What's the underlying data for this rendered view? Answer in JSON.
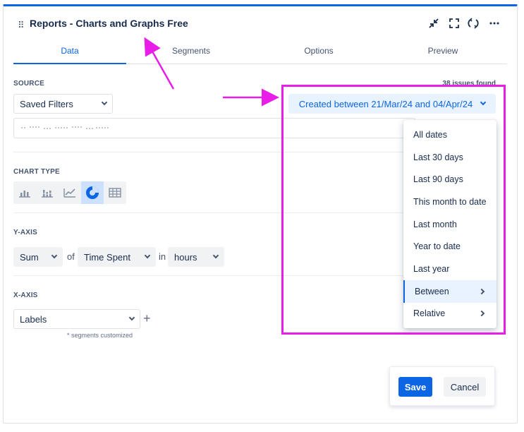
{
  "window": {
    "title": "Reports - Charts and Graphs Free"
  },
  "icons": [
    "drag-handle-icon",
    "minimize-icon",
    "fullscreen-icon",
    "refresh-icon",
    "more-icon"
  ],
  "tabs": [
    {
      "label": "Data",
      "active": true
    },
    {
      "label": "Segments"
    },
    {
      "label": "Options"
    },
    {
      "label": "Preview"
    }
  ],
  "source": {
    "label": "SOURCE",
    "type_value": "Saved Filters",
    "filter_value": "",
    "issues_count": "38 issues found",
    "date_range": "Created between 21/Mar/24 and 04/Apr/24"
  },
  "chart_type": {
    "label": "CHART TYPE",
    "options": [
      "bar-chart-icon",
      "stacked-bar-icon",
      "line-chart-icon",
      "donut-chart-icon",
      "table-icon"
    ],
    "selected": "donut-chart-icon"
  },
  "y_axis": {
    "label": "Y-AXIS",
    "aggregate": "Sum",
    "of_text": "of",
    "field": "Time Spent",
    "in_text": "in",
    "unit": "hours"
  },
  "x_axis": {
    "label": "X-AXIS",
    "value": "Labels",
    "note": "* segments customized"
  },
  "date_menu": {
    "items": [
      {
        "label": "All dates"
      },
      {
        "label": "Last 30 days"
      },
      {
        "label": "Last 90 days"
      },
      {
        "label": "This month to date"
      },
      {
        "label": "Last month"
      },
      {
        "label": "Year to date"
      },
      {
        "label": "Last year"
      },
      {
        "label": "Between",
        "submenu": true,
        "active": true
      },
      {
        "label": "Relative",
        "submenu": true
      }
    ]
  },
  "footer": {
    "save_label": "Save",
    "cancel_label": "Cancel"
  },
  "colors": {
    "accent": "#0c66e4",
    "annotation": "#e81ee8"
  }
}
